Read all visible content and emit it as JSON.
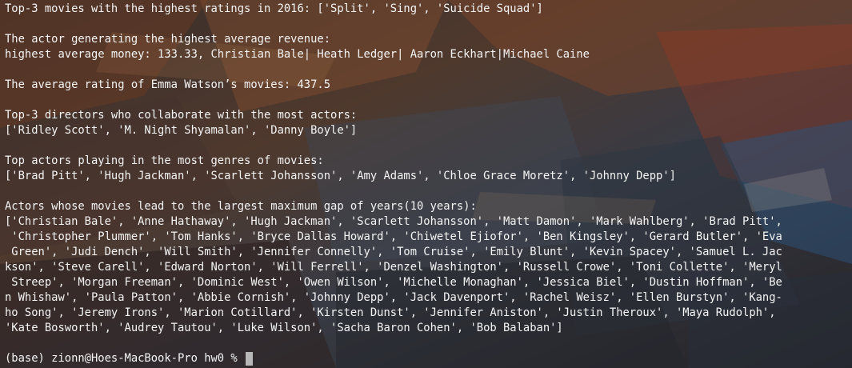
{
  "terminal": {
    "lines": [
      "Top-3 movies with the highest ratings in 2016: ['Split', 'Sing', 'Suicide Squad']",
      "",
      "The actor generating the highest average revenue:",
      "highest average money: 133.33, Christian Bale| Heath Ledger| Aaron Eckhart|Michael Caine",
      "",
      "The average rating of Emma Watson’s movies: 437.5",
      "",
      "Top-3 directors who collaborate with the most actors:",
      "['Ridley Scott', 'M. Night Shyamalan', 'Danny Boyle']",
      "",
      "Top actors playing in the most genres of movies:",
      "['Brad Pitt', 'Hugh Jackman', 'Scarlett Johansson', 'Amy Adams', 'Chloe Grace Moretz', 'Johnny Depp']",
      "",
      "Actors whose movies lead to the largest maximum gap of years(10 years):",
      "['Christian Bale', 'Anne Hathaway', 'Hugh Jackman', 'Scarlett Johansson', 'Matt Damon', 'Mark Wahlberg', 'Brad Pitt',",
      " 'Christopher Plummer', 'Tom Hanks', 'Bryce Dallas Howard', 'Chiwetel Ejiofor', 'Ben Kingsley', 'Gerard Butler', 'Eva",
      " Green', 'Judi Dench', 'Will Smith', 'Jennifer Connelly', 'Tom Cruise', 'Emily Blunt', 'Kevin Spacey', 'Samuel L. Jac",
      "kson', 'Steve Carell', 'Edward Norton', 'Will Ferrell', 'Denzel Washington', 'Russell Crowe', 'Toni Collette', 'Meryl",
      " Streep', 'Morgan Freeman', 'Dominic West', 'Owen Wilson', 'Michelle Monaghan', 'Jessica Biel', 'Dustin Hoffman', 'Be",
      "n Whishaw', 'Paula Patton', 'Abbie Cornish', 'Johnny Depp', 'Jack Davenport', 'Rachel Weisz', 'Ellen Burstyn', 'Kang-",
      "ho Song', 'Jeremy Irons', 'Marion Cotillard', 'Kirsten Dunst', 'Jennifer Aniston', 'Justin Theroux', 'Maya Rudolph',",
      "'Kate Bosworth', 'Audrey Tautou', 'Luke Wilson', 'Sacha Baron Cohen', 'Bob Balaban']",
      ""
    ],
    "prompt": "(base) zionn@Hoes-MacBook-Pro hw0 % "
  }
}
